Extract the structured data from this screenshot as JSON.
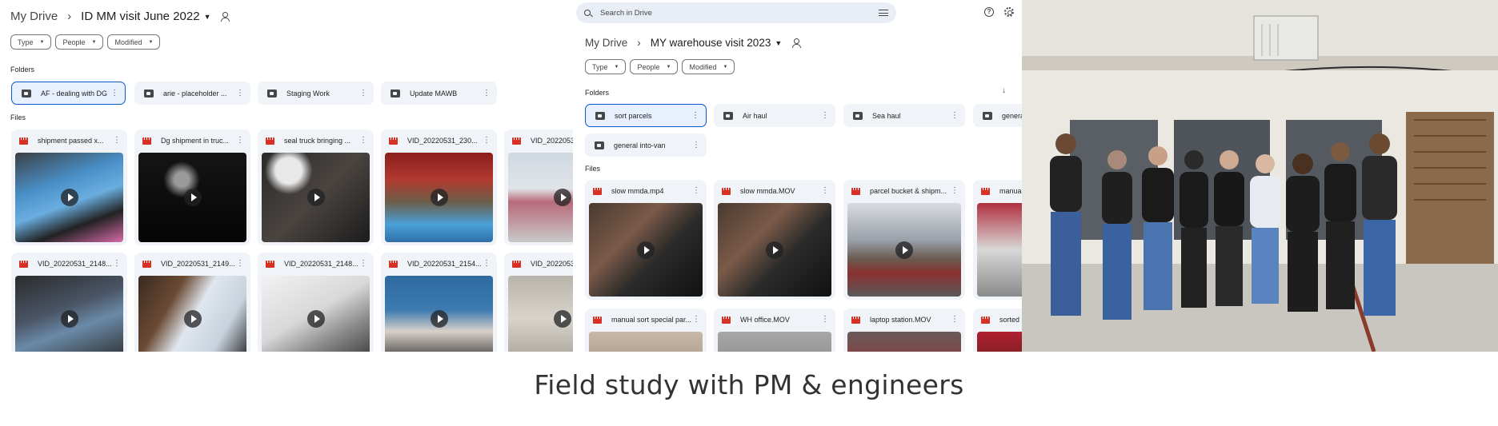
{
  "panel1": {
    "breadcrumb": {
      "root": "My Drive",
      "current": "ID MM visit June 2022"
    },
    "filters": [
      "Type",
      "People",
      "Modified"
    ],
    "folders_label": "Folders",
    "files_label": "Files",
    "folders": [
      "AF - dealing with DG",
      "arie - placeholder ...",
      "Staging Work",
      "Update MAWB"
    ],
    "files": [
      "shipment passed x...",
      "Dg shipment in truc...",
      "seal truck bringing ...",
      "VID_20220531_230...",
      "VID_2022053",
      "VID_20220531_2148...",
      "VID_20220531_2149...",
      "VID_20220531_2148...",
      "VID_20220531_2154...",
      "VID_2022053"
    ]
  },
  "panel2": {
    "search_placeholder": "Search in Drive",
    "breadcrumb": {
      "root": "My Drive",
      "current": "MY warehouse visit 2023"
    },
    "filters": [
      "Type",
      "People",
      "Modified"
    ],
    "folders_label": "Folders",
    "files_label": "Files",
    "folders": [
      "sort parcels",
      "Air haul",
      "Sea haul",
      "general",
      "general into-van"
    ],
    "files": [
      "slow mmda.mp4",
      "slow mmda.MOV",
      "parcel bucket & shipm...",
      "manual",
      "manual sort special par...",
      "WH office.MOV",
      "laptop station.MOV",
      "sorted s"
    ]
  },
  "caption": "Field study with PM & engineers",
  "colors": {
    "accent": "#0b57d0",
    "video_icon": "#d93025",
    "surface": "#f0f4f9"
  }
}
